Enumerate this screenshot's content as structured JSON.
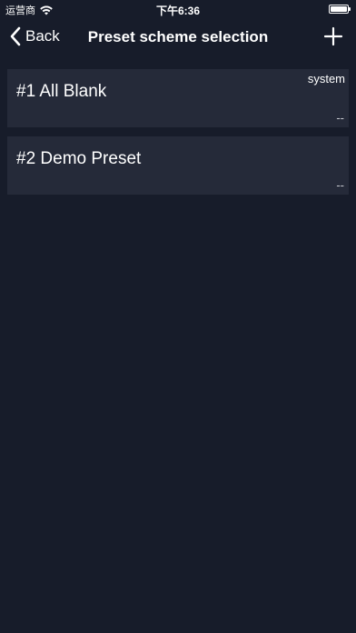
{
  "status_bar": {
    "carrier": "运营商",
    "time": "下午6:36",
    "wifi_icon": "wifi-icon",
    "battery_icon": "battery-icon"
  },
  "nav": {
    "back_label": "Back",
    "back_icon": "chevron-left-icon",
    "title": "Preset scheme selection",
    "add_icon": "plus-icon"
  },
  "presets": [
    {
      "name": "#1 All Blank",
      "tag": "system",
      "sub": "--"
    },
    {
      "name": "#2 Demo Preset",
      "tag": "",
      "sub": "--"
    }
  ],
  "colors": {
    "background": "#171c2a",
    "card": "#252a39",
    "text": "#ffffff"
  }
}
